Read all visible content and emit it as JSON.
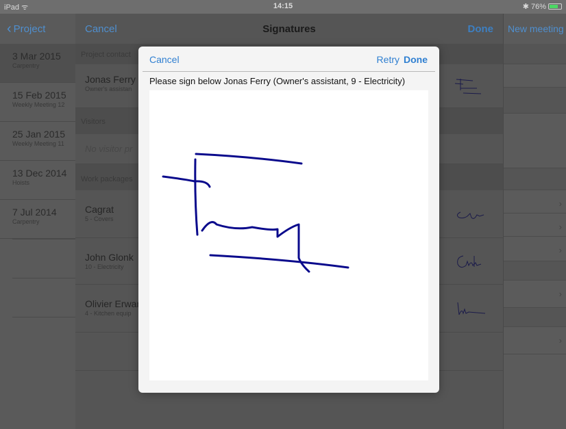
{
  "status_bar": {
    "carrier": "iPad ᯤ",
    "time": "14:15",
    "battery": "76%",
    "battery_level": 0.76
  },
  "left": {
    "back_label": "Project",
    "meetings": [
      {
        "date": "3 Mar 2015",
        "subtitle": "Carpentry"
      },
      {
        "date": "15 Feb 2015",
        "subtitle": "Weekly Meeting 12"
      },
      {
        "date": "25 Jan 2015",
        "subtitle": "Weekly Meeting 11"
      },
      {
        "date": "13 Dec 2014",
        "subtitle": "Hoists"
      },
      {
        "date": "7 Jul 2014",
        "subtitle": "Carpentry"
      }
    ]
  },
  "middle": {
    "cancel_label": "Cancel",
    "title": "Signatures",
    "done_label": "Done",
    "sections": {
      "contacts": "Project contact",
      "visitors": "Visitors",
      "work_packages": "Work packages"
    },
    "contact": {
      "name": "Jonas Ferry",
      "role": "Owner's assistan"
    },
    "visitor_placeholder": "No visitor pr",
    "packages": [
      {
        "name": "Cagrat",
        "role": "5 - Covers"
      },
      {
        "name": "John Glonk",
        "role": "10 - Electricity"
      },
      {
        "name": "Olivier Erwar",
        "role": "4 - Kitchen equip"
      }
    ]
  },
  "right": {
    "new_meeting_label": "New meeting"
  },
  "modal": {
    "cancel_label": "Cancel",
    "retry_label": "Retry",
    "done_label": "Done",
    "prompt": "Please sign below Jonas Ferry (Owner's assistant, 9 - Electricity)",
    "ink_color": "#0a0a8c"
  }
}
